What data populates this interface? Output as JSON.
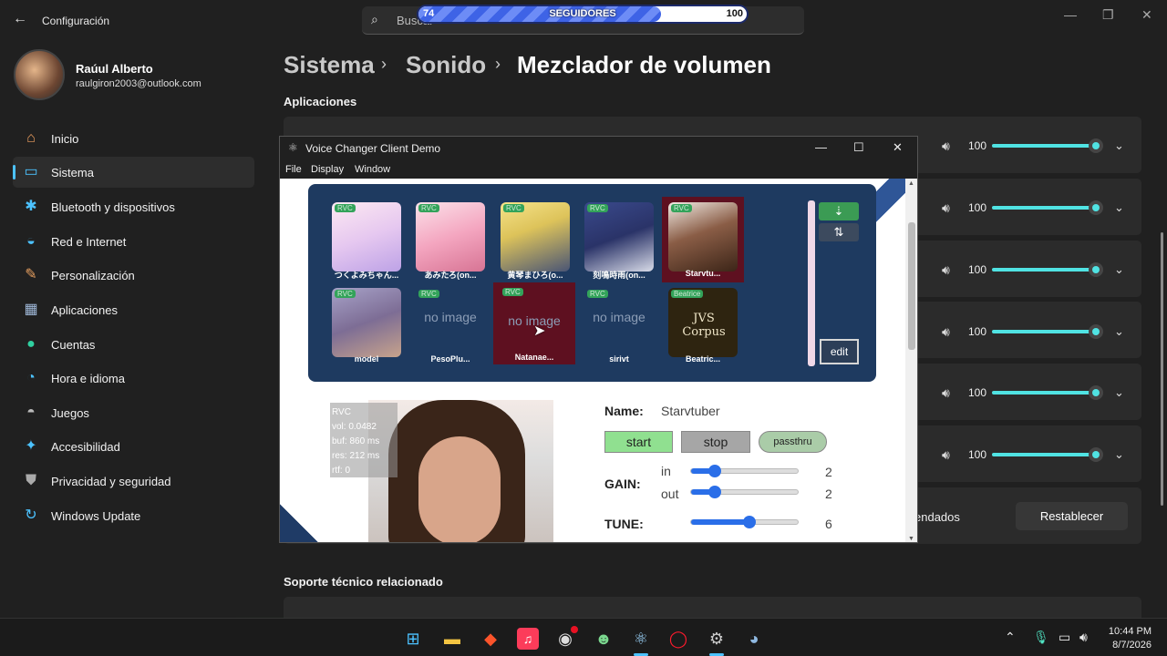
{
  "settings": {
    "app_title": "Configuración",
    "search_placeholder": "Buscar",
    "profile": {
      "name": "Raúul Alberto",
      "email": "raulgiron2003@outlook.com"
    },
    "nav": [
      {
        "label": "Inicio",
        "icon": "home-icon"
      },
      {
        "label": "Sistema",
        "icon": "monitor-icon",
        "selected": true
      },
      {
        "label": "Bluetooth y dispositivos",
        "icon": "bluetooth-icon"
      },
      {
        "label": "Red e Internet",
        "icon": "wifi-icon"
      },
      {
        "label": "Personalización",
        "icon": "brush-icon"
      },
      {
        "label": "Aplicaciones",
        "icon": "apps-icon"
      },
      {
        "label": "Cuentas",
        "icon": "person-icon"
      },
      {
        "label": "Hora e idioma",
        "icon": "globe-clock-icon"
      },
      {
        "label": "Juegos",
        "icon": "gamepad-icon"
      },
      {
        "label": "Accesibilidad",
        "icon": "accessibility-icon"
      },
      {
        "label": "Privacidad y seguridad",
        "icon": "shield-icon"
      },
      {
        "label": "Windows Update",
        "icon": "update-icon"
      }
    ],
    "breadcrumb": [
      "Sistema",
      "Sonido",
      "Mezclador de volumen"
    ],
    "section_apps": "Aplicaciones",
    "app_volumes": [
      "100",
      "100",
      "100",
      "100",
      "100",
      "100"
    ],
    "reset_row_text": "endados",
    "reset_button": "Restablecer",
    "section_support": "Soporte técnico relacionado"
  },
  "followers": {
    "label": "SEGUIDORES",
    "current": "74",
    "goal": "100",
    "progress": 0.74
  },
  "voice_changer": {
    "title": "Voice Changer Client Demo",
    "menu": [
      "File",
      "Display",
      "Window"
    ],
    "models": [
      {
        "name": "つくよみちゃん...",
        "tag": "RVC",
        "image": true
      },
      {
        "name": "あみたろ(on...",
        "tag": "RVC",
        "image": true
      },
      {
        "name": "黄琴まひろ(o...",
        "tag": "RVC",
        "image": true
      },
      {
        "name": "刻鳴時雨(on...",
        "tag": "RVC",
        "image": true
      },
      {
        "name": "Starvtu...",
        "tag": "RVC",
        "image": true,
        "selected": true
      },
      {
        "name": "model",
        "tag": "RVC",
        "image": true
      },
      {
        "name": "PesoPlu...",
        "tag": "RVC",
        "image": false,
        "noimage_text": "no image"
      },
      {
        "name": "Natanae...",
        "tag": "RVC",
        "image": false,
        "noimage_text": "no image",
        "selected": true
      },
      {
        "name": "sirivt",
        "tag": "RVC",
        "image": false,
        "noimage_text": "no image"
      },
      {
        "name": "Beatric...",
        "tag": "Beatrice",
        "image": true,
        "caption": "JVS Corpus"
      }
    ],
    "edit_button": "edit",
    "stats": {
      "type": "RVC",
      "vol": "vol: 0.0482",
      "buf": "buf: 860 ms",
      "res": "res: 212 ms",
      "rtf": "rtf: 0"
    },
    "name_label": "Name:",
    "name_value": "Starvtuber",
    "start_button": "start",
    "stop_button": "stop",
    "passthru_button": "passthru",
    "gain_label": "GAIN:",
    "gain_in_label": "in",
    "gain_in_value": "2",
    "gain_in_level": 0.22,
    "gain_out_label": "out",
    "gain_out_value": "2",
    "gain_out_level": 0.22,
    "tune_label": "TUNE:",
    "tune_value": "6",
    "tune_level": 0.55
  },
  "taskbar": {
    "time": "10:44 PM",
    "date": "8/7/2026"
  },
  "colors": {
    "accent": "#4cc2ff",
    "slider": "#50e3e3",
    "panel": "#1e3a60",
    "start_bg": "#90e090",
    "stop_bg": "#a6a6a6"
  }
}
